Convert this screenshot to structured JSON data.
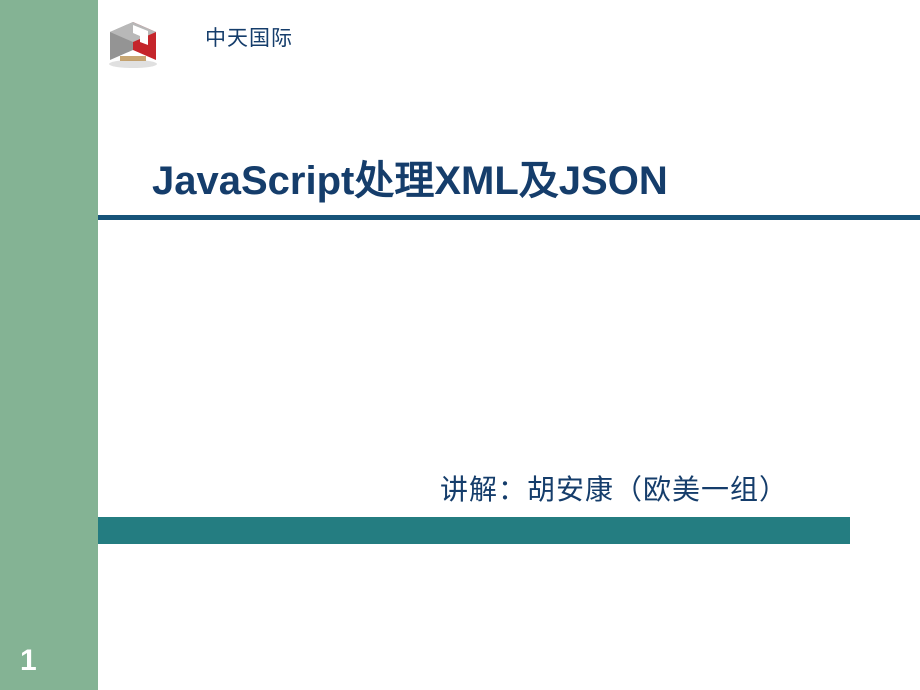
{
  "header": {
    "company": "中天国际"
  },
  "title": "JavaScript处理XML及JSON",
  "presenter": "讲解：胡安康（欧美一组）",
  "pageNumber": "1",
  "colors": {
    "sidebarGreen": "#84b394",
    "darkBlue": "#153d6b",
    "tealGreen": "#247d81",
    "underlineBlue": "#175479"
  }
}
